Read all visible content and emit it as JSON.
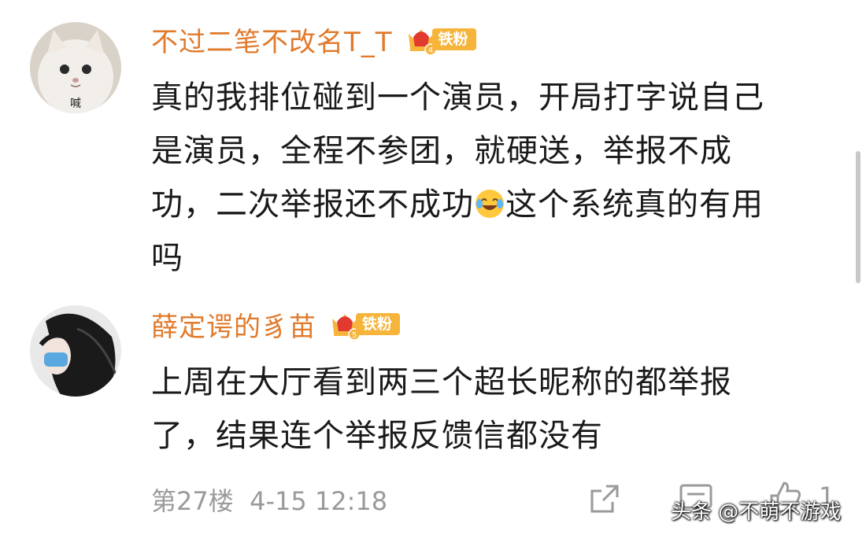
{
  "comments": [
    {
      "username": "不过二笔不改名T_T",
      "badge": {
        "level": "4",
        "label": "铁粉"
      },
      "avatar_text": "喊",
      "lines": [
        "真的我排位碰到一个演员，开局打字说自己",
        "是演员，全程不参团，就硬送，举报不成",
        "功，二次举报还不成功",
        "吗"
      ],
      "line3_after_emoji": "这个系统真的有用",
      "emoji": "laugh-cry-emoji"
    },
    {
      "username": "薛定谔的豸苗",
      "badge": {
        "level": "5",
        "label": "铁粉"
      },
      "lines": [
        "上周在大厅看到两三个超长昵称的都举报",
        "了，结果连个举报反馈信都没有"
      ]
    }
  ],
  "footer": {
    "floor": "第27楼",
    "time": "4-15 12:18",
    "like_count": "1"
  },
  "watermark": "头条 @不萌不游戏",
  "colors": {
    "username": "#e07a2c",
    "badge": "#f6b43a",
    "meta": "#9a9a9a"
  }
}
